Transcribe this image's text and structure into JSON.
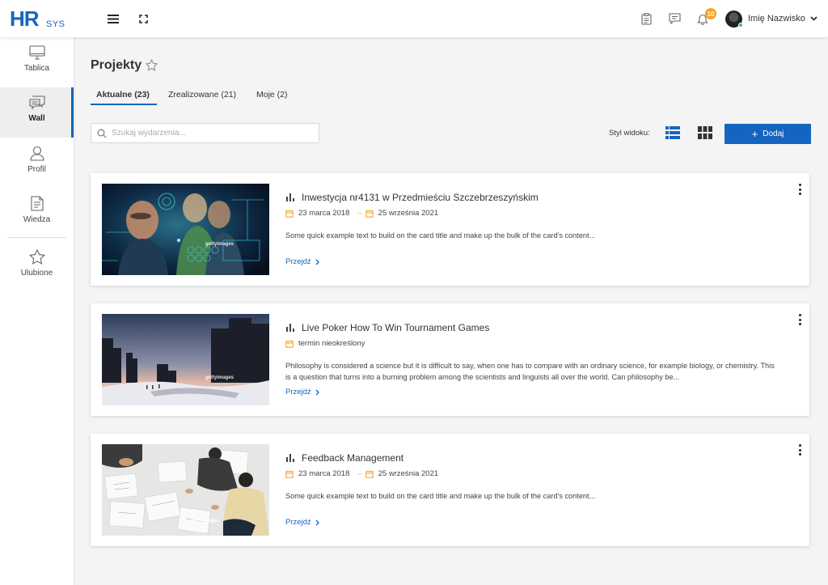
{
  "app": {
    "logo_main": "HR",
    "logo_sub": "SYS"
  },
  "header": {
    "notifications_count": "10",
    "user_name": "Imię Nazwisko"
  },
  "sidebar": {
    "items": [
      {
        "label": "Tablica",
        "icon": "monitor-icon",
        "active": false
      },
      {
        "label": "Wall",
        "icon": "chat-icon",
        "active": true
      },
      {
        "label": "Profil",
        "icon": "user-icon",
        "active": false
      },
      {
        "label": "Wiedza",
        "icon": "document-icon",
        "active": false
      },
      {
        "label": "Ulubione",
        "icon": "star-icon",
        "active": false
      }
    ]
  },
  "page": {
    "title": "Projekty",
    "tabs": [
      {
        "label": "Aktualne (23)",
        "active": true
      },
      {
        "label": "Zrealizowane (21)",
        "active": false
      },
      {
        "label": "Moje (2)",
        "active": false
      }
    ],
    "search_placeholder": "Szukaj wydarzenia...",
    "view_label": "Styl widoku:",
    "add_label": "Dodaj",
    "accent_color": "#1565c0",
    "date_icon_color": "#f5a623"
  },
  "cards": [
    {
      "title": "Inwestycja nr4131 w Przedmieściu Szczebrzeszyńskim",
      "date_start": "23 marca 2018",
      "date_end": "25 września 2021",
      "description": "Some quick example text to build on the card title and make up the bulk of the card's content...",
      "link": "Przejdź",
      "image_watermark": "gettyimages"
    },
    {
      "title": "Live Poker How To Win Tournament Games",
      "date_single": "termin nieokreślony",
      "description": "Philosophy is considered a science but it is difficult to say, when one has to compare with an ordinary science, for example biology, or chemistry. This is a question that turns into a burning problem among the scientists and linguists all over the world. Can philosophy be...",
      "link": "Przejdź",
      "image_watermark": "gettyimages"
    },
    {
      "title": "Feedback Management",
      "date_start": "23 marca 2018",
      "date_end": "25 września 2021",
      "description": "Some quick example text to build on the card title and make up the bulk of the card's content...",
      "link": "Przejdź",
      "image_watermark": "gettyimages"
    }
  ]
}
